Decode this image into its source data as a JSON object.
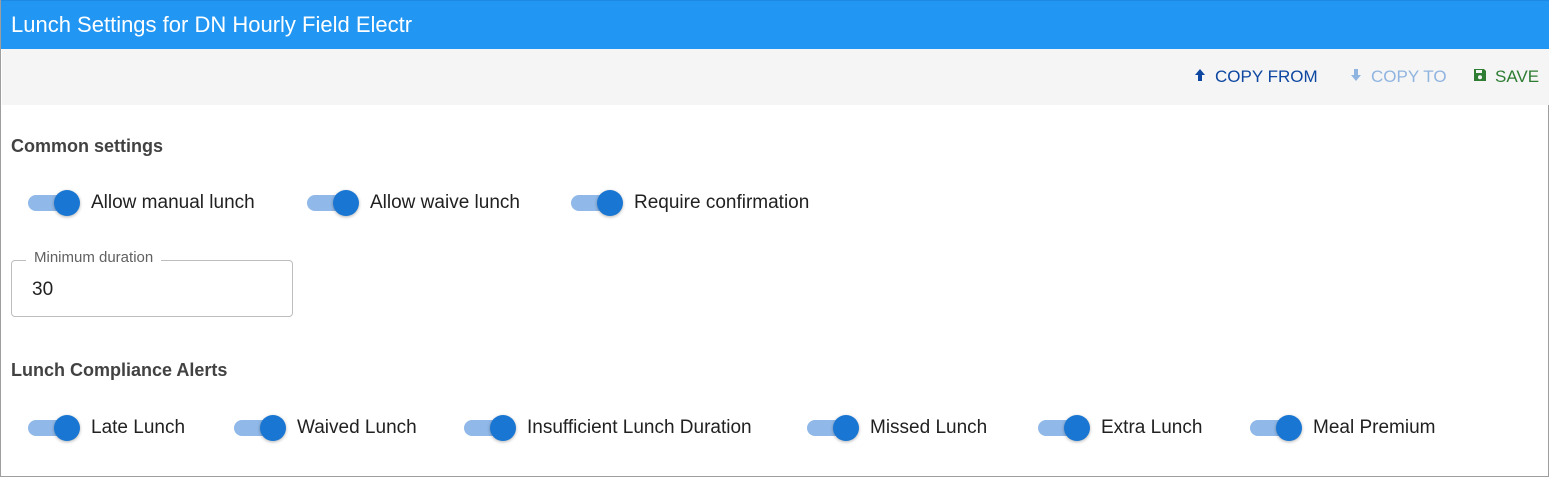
{
  "header": {
    "title": "Lunch Settings for DN Hourly Field Electr"
  },
  "toolbar": {
    "copy_from_label": "COPY FROM",
    "copy_to_label": "COPY TO",
    "save_label": "SAVE"
  },
  "common_settings": {
    "title": "Common settings",
    "toggles": [
      {
        "label": "Allow manual lunch",
        "on": true
      },
      {
        "label": "Allow waive lunch",
        "on": true
      },
      {
        "label": "Require confirmation",
        "on": true
      }
    ],
    "minimum_duration": {
      "label": "Minimum duration",
      "value": "30"
    }
  },
  "compliance_alerts": {
    "title": "Lunch Compliance Alerts",
    "toggles": [
      {
        "label": "Late Lunch",
        "on": true
      },
      {
        "label": "Waived Lunch",
        "on": true
      },
      {
        "label": "Insufficient Lunch Duration",
        "on": true
      },
      {
        "label": "Missed Lunch",
        "on": true
      },
      {
        "label": "Extra Lunch",
        "on": true
      },
      {
        "label": "Meal Premium",
        "on": true
      }
    ]
  },
  "colors": {
    "header_bg": "#2196f3",
    "switch_on": "#1976d2",
    "copy_from": "#0d47a1",
    "copy_to_disabled": "#90b4e0",
    "save": "#2e7d32"
  }
}
